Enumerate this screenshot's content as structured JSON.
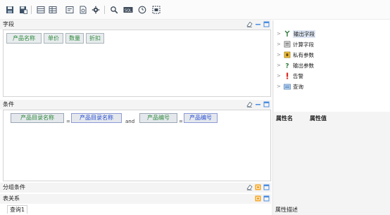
{
  "toolbar": {
    "buttons": [
      {
        "name": "save-icon"
      },
      {
        "name": "save-as-icon"
      },
      {
        "name": "table-layout-icon"
      },
      {
        "name": "grid-layout-icon"
      },
      {
        "name": "report-icon"
      },
      {
        "name": "document-refresh-icon"
      },
      {
        "name": "gear-icon"
      },
      {
        "name": "search-icon"
      },
      {
        "name": "sql-icon"
      },
      {
        "name": "clock-icon"
      },
      {
        "name": "id-icon"
      }
    ]
  },
  "fields": {
    "title": "字段",
    "chips": [
      "产品名称",
      "单价",
      "数量",
      "折扣"
    ]
  },
  "conditions": {
    "title": "条件",
    "left1": "产品目录名称",
    "op1": "=",
    "right1": "产品目录名称",
    "joiner": "and",
    "left2": "产品编号",
    "op2": "=",
    "right2": "产品编号"
  },
  "group": {
    "title": "分组条件"
  },
  "relation": {
    "title": "表关系"
  },
  "tree": {
    "items": [
      {
        "label": "输出字段",
        "icon": "output-field-icon",
        "selected": true
      },
      {
        "label": "计算字段",
        "icon": "calculated-field-icon",
        "selected": false
      },
      {
        "label": "私有参数",
        "icon": "private-param-icon",
        "selected": false
      },
      {
        "label": "输出参数",
        "icon": "output-param-icon",
        "selected": false
      },
      {
        "label": "告警",
        "icon": "alert-icon",
        "selected": false
      },
      {
        "label": "查询",
        "icon": "query-icon",
        "selected": false
      }
    ]
  },
  "properties": {
    "name_header": "属性名",
    "value_header": "属性值",
    "description_label": "属性描述"
  },
  "bottom_tab": {
    "label": "查询1"
  },
  "colors": {
    "field_text": "#2f8a3c",
    "param_text": "#2b4fd6",
    "selection": "#dde6f3"
  }
}
